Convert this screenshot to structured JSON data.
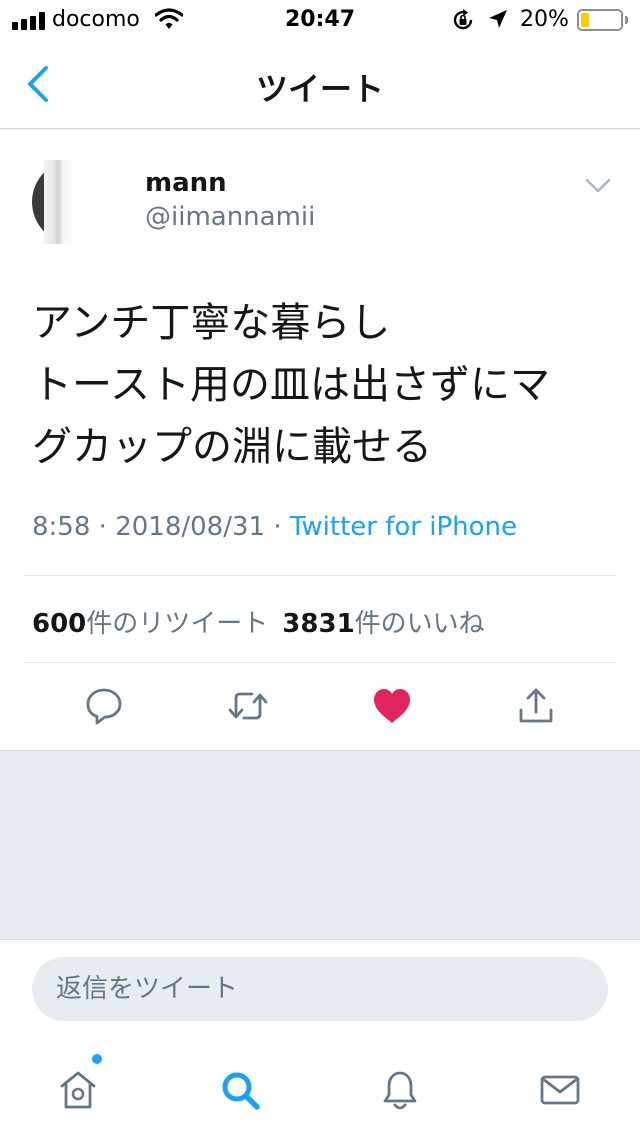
{
  "status_bar": {
    "carrier": "docomo",
    "time": "20:47",
    "battery_percent": "20%",
    "battery_level": 0.2,
    "icons": [
      "signal-icon",
      "wifi-icon",
      "rotation-lock-icon",
      "location-arrow-icon",
      "battery-icon"
    ]
  },
  "nav": {
    "title": "ツイート",
    "back_icon": "chevron-left-icon"
  },
  "tweet": {
    "user": {
      "name": "mann",
      "handle": "@iimannamii"
    },
    "text_lines": [
      "アンチ丁寧な暮らし",
      "トースト用の皿は出さずにマ",
      "グカップの淵に載せる"
    ],
    "time": "8:58",
    "date": "2018/08/31",
    "separator": "·",
    "source": "Twitter for iPhone",
    "stats": {
      "retweets_count": "600",
      "retweets_label": "件のリツイート",
      "likes_count": "3831",
      "likes_label": "件のいいね"
    },
    "liked": true
  },
  "actions": [
    "reply-icon",
    "retweet-icon",
    "like-heart-icon",
    "share-icon"
  ],
  "reply": {
    "placeholder": "返信をツイート"
  },
  "tab_bar": {
    "tabs": [
      "home-icon",
      "search-icon",
      "notifications-bell-icon",
      "messages-envelope-icon"
    ],
    "active": "search-icon"
  },
  "colors": {
    "accent": "#1da1f2",
    "like": "#e0245e",
    "secondary_text": "#657786",
    "background_gray": "#e6ecf0",
    "battery": "#ffcc00"
  }
}
